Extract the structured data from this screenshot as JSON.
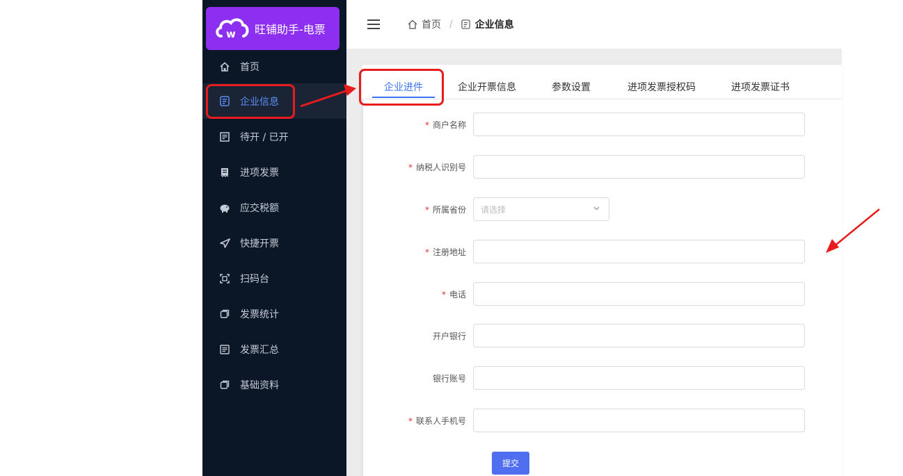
{
  "app": {
    "title": "旺铺助手-电票"
  },
  "breadcrumb": {
    "home": "首页",
    "separator": "/",
    "current": "企业信息"
  },
  "sidebar": {
    "items": [
      {
        "label": "首页",
        "icon": "home-icon"
      },
      {
        "label": "企业信息",
        "icon": "document-icon",
        "active": true
      },
      {
        "label": "待开 / 已开",
        "icon": "invoice-icon"
      },
      {
        "label": "进项发票",
        "icon": "receipt-icon"
      },
      {
        "label": "应交税额",
        "icon": "piggy-bank-icon"
      },
      {
        "label": "快捷开票",
        "icon": "send-icon"
      },
      {
        "label": "扫码台",
        "icon": "scan-icon"
      },
      {
        "label": "发票统计",
        "icon": "window-icon"
      },
      {
        "label": "发票汇总",
        "icon": "checklist-icon"
      },
      {
        "label": "基础资料",
        "icon": "window-icon"
      }
    ]
  },
  "tabs": [
    {
      "label": "企业进件",
      "active": true
    },
    {
      "label": "企业开票信息"
    },
    {
      "label": "参数设置"
    },
    {
      "label": "进项发票授权码"
    },
    {
      "label": "进项发票证书"
    }
  ],
  "form": {
    "fields": [
      {
        "label": "商户名称",
        "required": true,
        "type": "input",
        "value": ""
      },
      {
        "label": "纳税人识别号",
        "required": true,
        "type": "input",
        "value": ""
      },
      {
        "label": "所属省份",
        "required": true,
        "type": "select",
        "placeholder": "请选择"
      },
      {
        "label": "注册地址",
        "required": true,
        "type": "input",
        "value": ""
      },
      {
        "label": "电话",
        "required": true,
        "type": "input",
        "value": ""
      },
      {
        "label": "开户银行",
        "required": false,
        "type": "input",
        "value": ""
      },
      {
        "label": "银行账号",
        "required": false,
        "type": "input",
        "value": ""
      },
      {
        "label": "联系人手机号",
        "required": true,
        "type": "input",
        "value": ""
      }
    ],
    "required_mark": "*",
    "submit_label": "提交"
  },
  "colors": {
    "sidebar_bg": "#0b1627",
    "logo_bg": "#8c2ff0",
    "accent": "#3d74f5",
    "annotation_red": "#e81c1c",
    "submit_bg": "#4f6ff0"
  }
}
